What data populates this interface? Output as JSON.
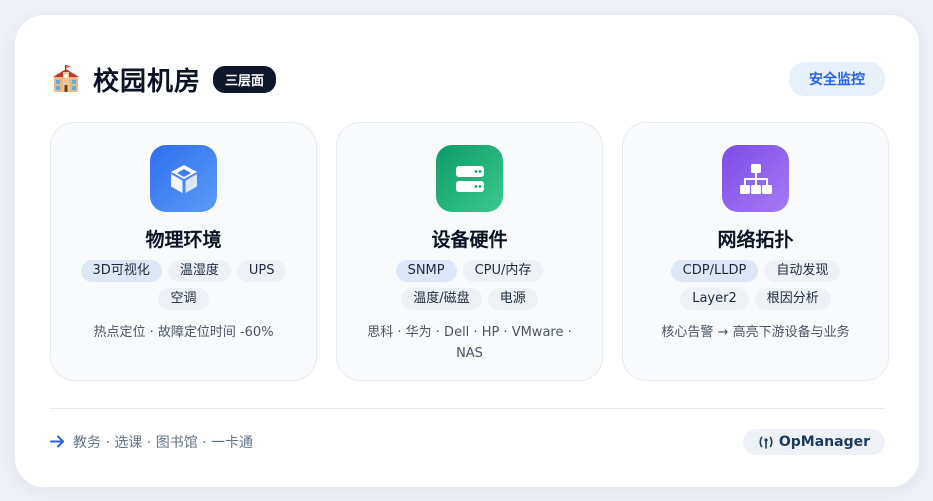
{
  "header": {
    "title": "校园机房",
    "badge": "三层面",
    "action_label": "安全监控",
    "icon": "school-icon"
  },
  "panels": [
    {
      "title": "物理环境",
      "icon": "cube-icon",
      "color": "#2f6ff0",
      "tags": [
        "3D可视化",
        "温湿度",
        "UPS",
        "空调"
      ],
      "description": "热点定位 · 故障定位时间 -60%"
    },
    {
      "title": "设备硬件",
      "icon": "server-icon",
      "color": "#0e9b6a",
      "tags": [
        "SNMP",
        "CPU/内存",
        "温度/磁盘",
        "电源"
      ],
      "description": "思科 · 华为 · Dell · HP · VMware · NAS"
    },
    {
      "title": "网络拓扑",
      "icon": "network-icon",
      "color": "#7b4ce8",
      "tags": [
        "CDP/LLDP",
        "自动发现",
        "Layer2",
        "根因分析"
      ],
      "description": "核心告警 → 高亮下游设备与业务"
    }
  ],
  "footer": {
    "icon": "arrow-right-icon",
    "text": "教务 · 选课 · 图书馆 · 一卡通",
    "product_icon": "antenna-icon",
    "product": "OpManager"
  }
}
